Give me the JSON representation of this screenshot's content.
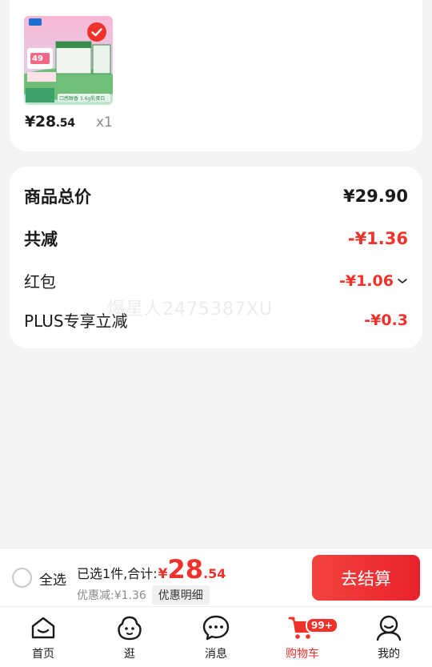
{
  "product": {
    "price_int": "¥28",
    "price_dec": ".54",
    "quantity": "x1",
    "image_caption_1": "49",
    "image_caption_2": "口感醇香 3.6g乳蛋白"
  },
  "summary": {
    "goods_total_label": "商品总价",
    "goods_total_value": "¥29.90",
    "total_reduce_label": "共减",
    "total_reduce_value": "-¥1.36",
    "red_packet_label": "红包",
    "red_packet_value": "-¥1.06",
    "plus_label": "PLUS专享立减",
    "plus_value": "-¥0.3"
  },
  "watermark": "爆星人2475387XU",
  "checkout": {
    "select_all": "全选",
    "selected_text": "已选1件,合计:",
    "total_symbol": "¥",
    "total_int": "28",
    "total_dec": ".54",
    "discount_text": "优惠减:¥1.36",
    "detail_label": "优惠明细",
    "button_label": "去结算"
  },
  "tabs": [
    {
      "label": "首页",
      "icon": "home-icon"
    },
    {
      "label": "逛",
      "icon": "browse-icon"
    },
    {
      "label": "消息",
      "icon": "message-icon"
    },
    {
      "label": "购物车",
      "icon": "cart-icon",
      "badge": "99+",
      "active": true
    },
    {
      "label": "我的",
      "icon": "profile-icon"
    }
  ],
  "colors": {
    "accent": "#f0322b",
    "background": "#f4f4f4"
  }
}
